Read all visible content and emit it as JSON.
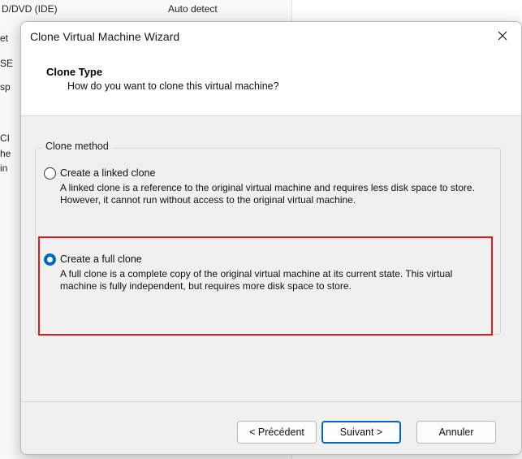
{
  "background": {
    "rows": [
      "D/DVD (IDE)",
      "Auto detect",
      "et",
      "SE",
      "sp",
      "CI",
      "he",
      "in"
    ]
  },
  "dialog": {
    "title": "Clone Virtual Machine Wizard",
    "close_icon": "close-icon",
    "header": {
      "title": "Clone Type",
      "subtitle": "How do you want to clone this virtual machine?"
    },
    "group_label": "Clone method",
    "options": [
      {
        "label": "Create a linked clone",
        "description": "A linked clone is a reference to the original virtual machine and requires less disk space to store. However, it cannot run without access to the original virtual machine.",
        "selected": false
      },
      {
        "label": "Create a full clone",
        "description": "A full clone is a complete copy of the original virtual machine at its current state. This virtual machine is fully independent, but requires more disk space to store.",
        "selected": true
      }
    ],
    "buttons": {
      "back": "< Précédent",
      "next": "Suivant >",
      "cancel": "Annuler"
    },
    "colors": {
      "accent": "#0067c0",
      "highlight": "#e0191c"
    }
  }
}
